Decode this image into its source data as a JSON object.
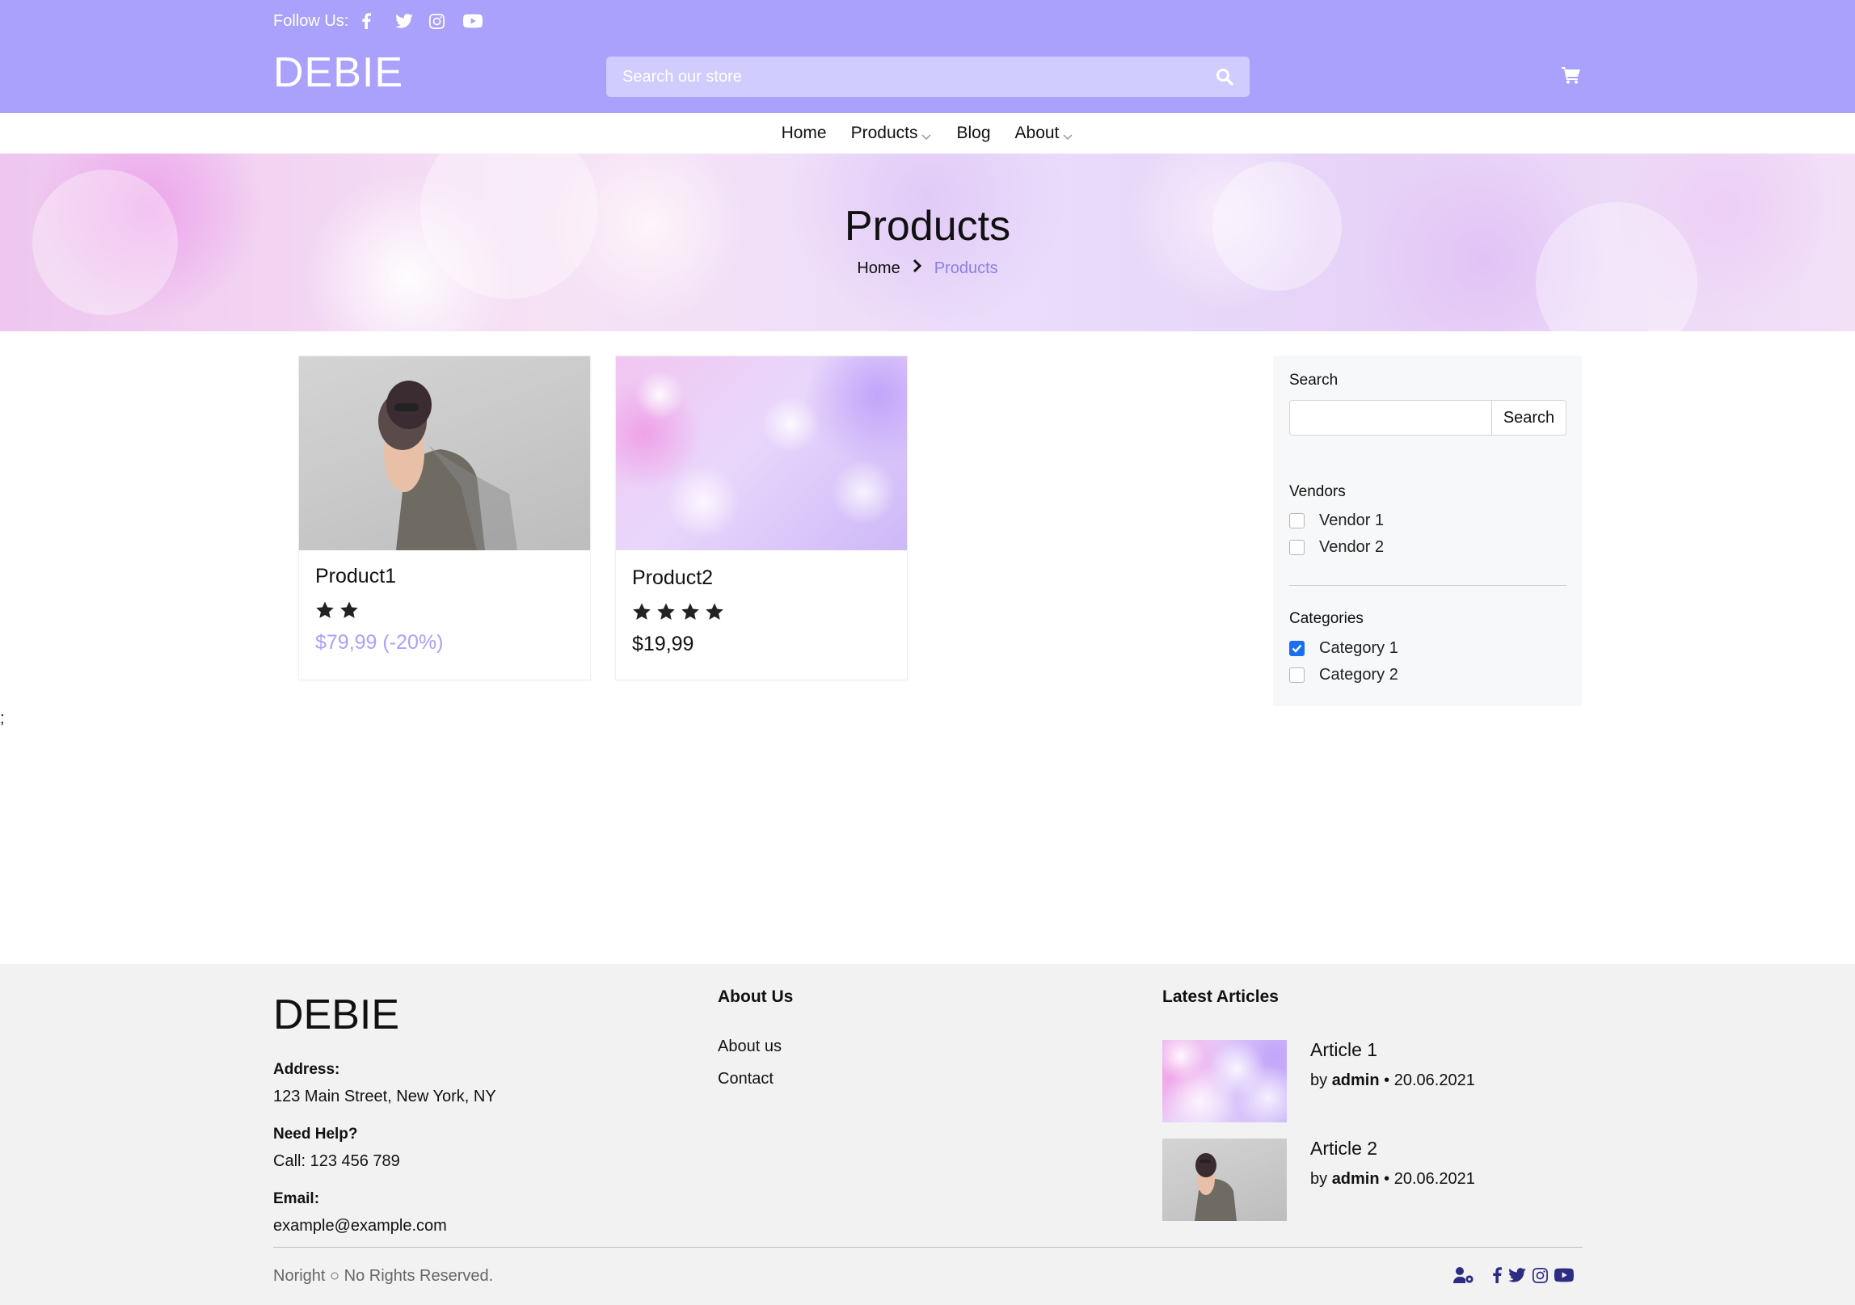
{
  "header": {
    "follow_label": "Follow Us:",
    "social_icons": [
      "facebook-icon",
      "twitter-icon",
      "instagram-icon",
      "youtube-icon"
    ],
    "logo": "DEBIE",
    "search_placeholder": "Search our store",
    "cart_icon": "cart-icon",
    "background_color": "#a9a1fb"
  },
  "nav": {
    "items": [
      {
        "label": "Home",
        "dropdown": false
      },
      {
        "label": "Products",
        "dropdown": true
      },
      {
        "label": "Blog",
        "dropdown": false
      },
      {
        "label": "About",
        "dropdown": true
      }
    ]
  },
  "banner": {
    "title": "Products",
    "breadcrumb": {
      "home": "Home",
      "current": "Products"
    }
  },
  "products": [
    {
      "name": "Product1",
      "rating": 2,
      "price": "$79,99 (-20%)",
      "on_sale": true,
      "price_color": "#a9a1fb"
    },
    {
      "name": "Product2",
      "rating": 4,
      "price": "$19,99",
      "on_sale": false,
      "price_color": "#111111"
    }
  ],
  "sidebar": {
    "search_heading": "Search",
    "search_value": "",
    "search_button": "Search",
    "vendors_heading": "Vendors",
    "vendors": [
      {
        "label": "Vendor 1",
        "checked": false
      },
      {
        "label": "Vendor 2",
        "checked": false
      }
    ],
    "categories_heading": "Categories",
    "categories": [
      {
        "label": "Category 1",
        "checked": true
      },
      {
        "label": "Category 2",
        "checked": false
      }
    ]
  },
  "stray_text": ";",
  "footer": {
    "logo": "DEBIE",
    "address_label": "Address:",
    "address_value": "123 Main Street, New York, NY",
    "help_label": "Need Help?",
    "help_value": "Call: 123 456 789",
    "email_label": "Email:",
    "email_value": "example@example.com",
    "about_heading": "About Us",
    "about_links": [
      "About us",
      "Contact"
    ],
    "articles_heading": "Latest Articles",
    "articles": [
      {
        "title": "Article 1",
        "by": "by",
        "author": "admin",
        "date": "• 20.06.2021"
      },
      {
        "title": "Article 2",
        "by": "by",
        "author": "admin",
        "date": "• 20.06.2021"
      }
    ],
    "copyright": "Noright ○ No Rights Reserved.",
    "bottom_icons": [
      "user-cog-icon",
      "facebook-icon",
      "twitter-icon",
      "instagram-icon",
      "youtube-icon"
    ],
    "icon_color": "#2c2c83"
  }
}
